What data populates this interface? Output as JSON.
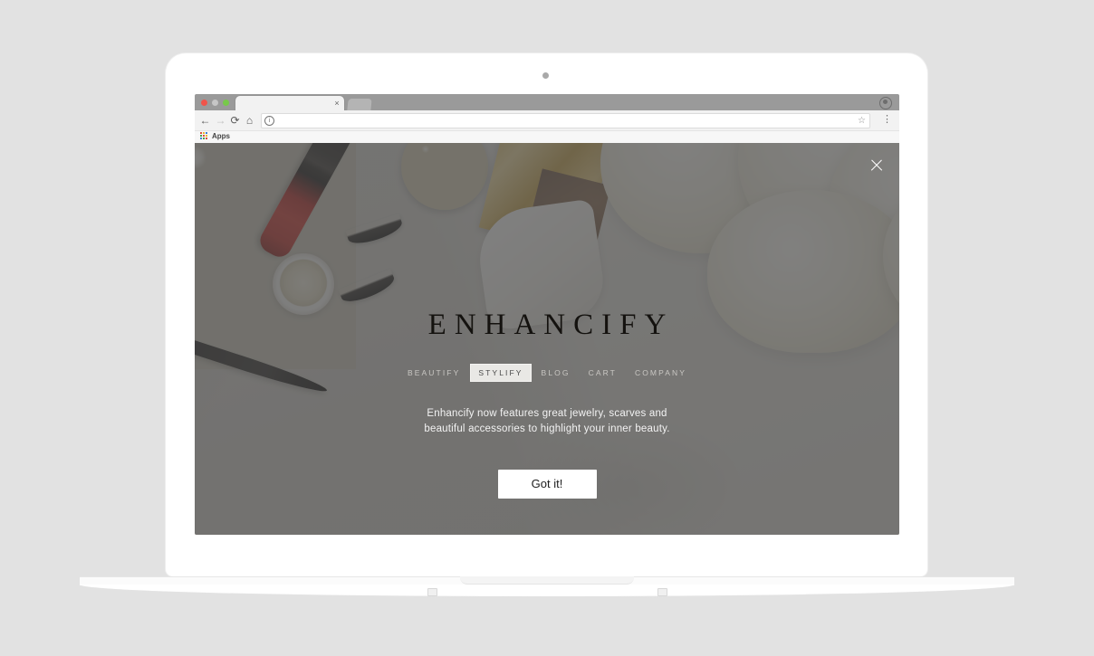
{
  "browser": {
    "window_controls": [
      "close",
      "minimize",
      "maximize"
    ],
    "tab_close_glyph": "×",
    "nav": {
      "back_glyph": "←",
      "forward_glyph": "→",
      "reload_glyph": "⟳",
      "home_glyph": "⌂"
    },
    "omnibox": {
      "value": "",
      "placeholder": "",
      "page_info_glyph": "i",
      "bookmark_star_glyph": "☆"
    },
    "menu_glyph": "⋮",
    "bookmarks": {
      "apps_label": "Apps"
    }
  },
  "site": {
    "brand": "ENHANCIFY",
    "nav_items": [
      {
        "label": "BEAUTIFY",
        "active": false
      },
      {
        "label": "STYLIFY",
        "active": true
      },
      {
        "label": "BLOG",
        "active": false
      },
      {
        "label": "CART",
        "active": false
      },
      {
        "label": "COMPANY",
        "active": false
      }
    ],
    "promo": {
      "text": "Enhancify now features great jewelry, scarves and beautiful accessories to highlight your inner beauty."
    },
    "cta": {
      "label": "Got it!"
    },
    "close_label": "×"
  },
  "colors": {
    "page_background": "#e2e2e2",
    "laptop_body": "#ffffff",
    "tab_strip": "#9a9a9a",
    "toolbar": "#f2f2f2",
    "overlay": "rgba(74,74,74,0.70)",
    "cta_background": "#ffffff",
    "cta_text": "#1d1d1d",
    "nav_inactive_text": "#c9c7c3",
    "nav_active_text": "#4a4a4a",
    "nav_active_background": "#e9e8e5",
    "brand_text": "#14120f",
    "promo_text": "#f3f3f3",
    "window_close_dot": "#f0544a",
    "window_min_dot": "#c6c6c6",
    "window_max_dot": "#77c94a"
  }
}
